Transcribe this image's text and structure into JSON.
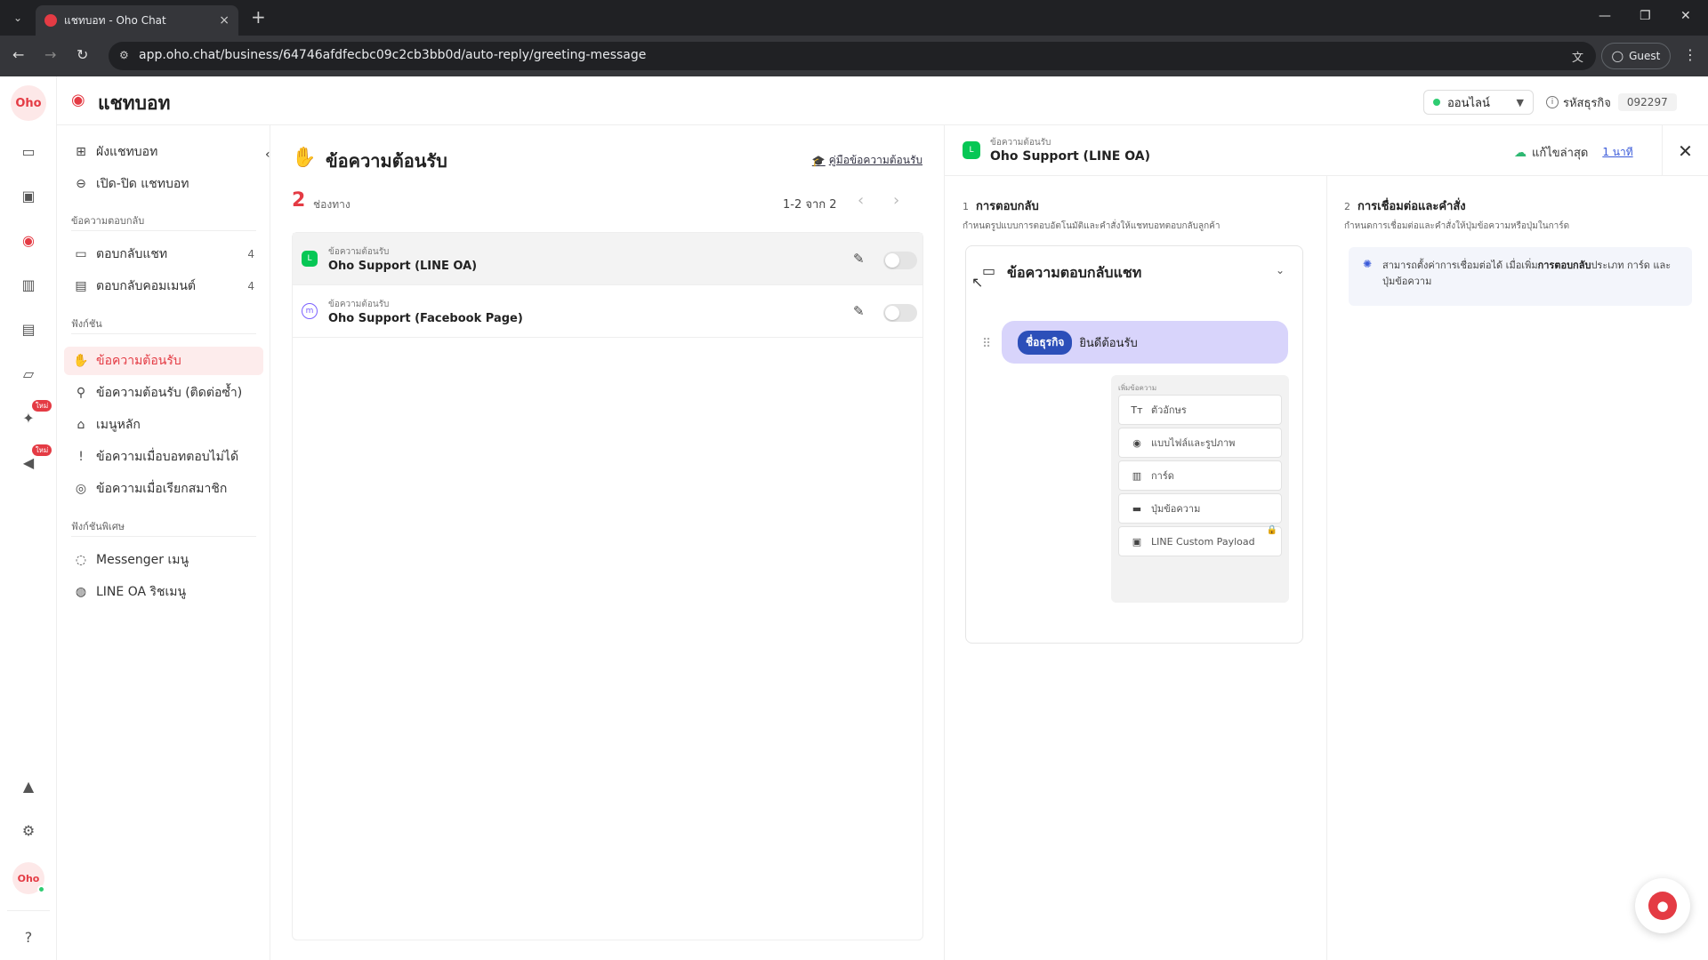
{
  "browser": {
    "tab_title": "แชทบอท - Oho Chat",
    "tab_close": "×",
    "new_tab": "+",
    "url": "app.oho.chat/business/64746afdfecbc09c2cb3bb0d/auto-reply/greeting-message",
    "profile": "Guest"
  },
  "header": {
    "title": "แชทบอท",
    "status": "ออนไลน์",
    "business_id_label": "รหัสธุรกิจ",
    "business_id": "092297"
  },
  "rail": {
    "logo": "Oho",
    "new_badge": "ใหม่",
    "avatar": "Oho"
  },
  "sidebar": {
    "top_items": [
      {
        "label": "ผังแชทบอท",
        "icon": "flow-chart-icon"
      },
      {
        "label": "เปิด-ปิด แชทบอท",
        "icon": "toggle-icon"
      }
    ],
    "section_reply": "ข้อความตอบกลับ",
    "reply_items": [
      {
        "label": "ตอบกลับแชท",
        "count": "4",
        "icon": "chat-reply-icon"
      },
      {
        "label": "ตอบกลับคอมเมนต์",
        "count": "4",
        "icon": "comment-reply-icon"
      }
    ],
    "section_function": "ฟังก์ชัน",
    "function_items": [
      {
        "label": "ข้อความต้อนรับ",
        "icon": "wave-hand-icon",
        "active": true
      },
      {
        "label": "ข้อความต้อนรับ (ติดต่อซ้ำ)",
        "icon": "person-walk-icon"
      },
      {
        "label": "เมนูหลัก",
        "icon": "home-icon"
      },
      {
        "label": "ข้อความเมื่อบอทตอบไม่ได้",
        "icon": "alert-message-icon"
      },
      {
        "label": "ข้อความเมื่อเรียกสมาชิก",
        "icon": "user-circle-icon"
      }
    ],
    "section_special": "ฟังก์ชันพิเศษ",
    "special_items": [
      {
        "label": "Messenger เมนู",
        "icon": "messenger-icon"
      },
      {
        "label": "LINE OA ริชเมนู",
        "icon": "line-icon"
      }
    ]
  },
  "middle": {
    "title": "ข้อความต้อนรับ",
    "guide_link": "คู่มือข้อความต้อนรับ",
    "count": "2",
    "count_label": "ช่องทาง",
    "pager": "1-2 จาก 2",
    "rows": [
      {
        "sub": "ข้อความต้อนรับ",
        "title": "Oho Support (LINE OA)",
        "channel": "line",
        "enabled": false
      },
      {
        "sub": "ข้อความต้อนรับ",
        "title": "Oho Support (Facebook Page)",
        "channel": "facebook",
        "enabled": false
      }
    ]
  },
  "detail": {
    "sub": "ข้อความต้อนรับ",
    "title": "Oho Support (LINE OA)",
    "saved_label": "แก้ไขล่าสุด",
    "saved_ago": "1 นาที",
    "step1_num": "1",
    "step1_title": "การตอบกลับ",
    "step1_desc": "กำหนดรูปแบบการตอบอัตโนมัติและคำสั่งให้แชทบอทตอบกลับลูกค้า",
    "step2_num": "2",
    "step2_title": "การเชื่อมต่อและคำสั่ง",
    "step2_desc": "กำหนดการเชื่อมต่อและคำสั่งให้ปุ่มข้อความหรือปุ่มในการ์ด",
    "card_title": "ข้อความตอบกลับแชท",
    "bubble_tag": "ชื่อธุรกิจ",
    "bubble_text": "ยินดีต้อนรับ",
    "add_label": "เพิ่มข้อความ",
    "options": [
      {
        "label": "ตัวอักษร",
        "icon": "text-icon"
      },
      {
        "label": "แบบไฟล์และรูปภาพ",
        "icon": "eye-icon"
      },
      {
        "label": "การ์ด",
        "icon": "card-icon"
      },
      {
        "label": "ปุ่มข้อความ",
        "icon": "button-message-icon"
      },
      {
        "label": "LINE Custom Payload",
        "icon": "code-icon",
        "locked": true
      }
    ],
    "tip_pre": "สามารถตั้งค่าการเชื่อมต่อได้ เมื่อเพิ่ม",
    "tip_bold": "การตอบกลับ",
    "tip_post": "ประเภท การ์ด และ ปุ่มข้อความ"
  },
  "colors": {
    "brand": "#e43b44",
    "line_green": "#06c755",
    "bubble": "#d8d4fb",
    "tag_blue": "#2c4fb9"
  }
}
